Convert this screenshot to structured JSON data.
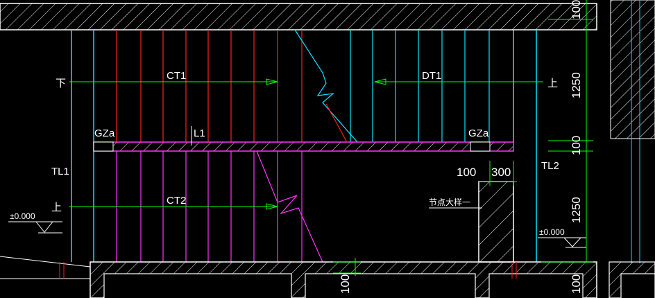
{
  "labels": {
    "down": "下",
    "ct1": "CT1",
    "dt1": "DT1",
    "up_right": "上",
    "gz_left": "GZa",
    "l1": "L1",
    "gz_right": "GZa",
    "tl1": "TL1",
    "elev_left": "±0.000",
    "up_left": "上",
    "ct2": "CT2",
    "detail": "节点大样一",
    "tl2": "TL2",
    "elev_right": "±0.000"
  },
  "dims": {
    "top_100": "100",
    "upper_1250": "1250",
    "mid_100": "100",
    "dim_100_left": "100",
    "dim_300": "300",
    "lower_1250": "1250",
    "bottom_100_mid": "100",
    "bottom_100_right": "100"
  },
  "colors": {
    "background": "#000000",
    "slab": "#ffffff",
    "hatch": "#ffffff",
    "dimension": "#00ff00",
    "tread_red": "#ff2020",
    "tread_cyan": "#00e5ff",
    "tread_magenta": "#ff33ff",
    "beam": "#ff33ff"
  }
}
